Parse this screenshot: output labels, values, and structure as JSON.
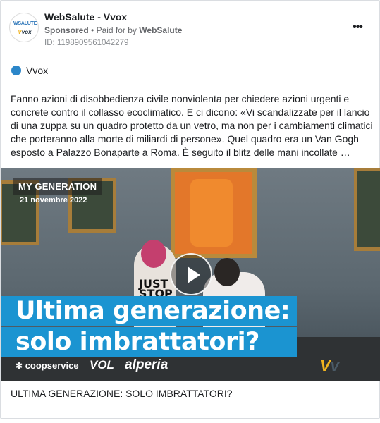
{
  "header": {
    "avatar_line1": "WSALUTE",
    "avatar_line2_a": "V",
    "avatar_line2_b": "vox",
    "page_name": "WebSalute - Vvox",
    "sponsored": "Sponsored",
    "separator": "•",
    "paid_for_by": "Paid for by",
    "payer": "WebSalute",
    "id_text": "ID: 1198909561042279",
    "more_icon": "•••"
  },
  "author": {
    "name": "Vvox",
    "dot_color": "#2b86c9"
  },
  "body": {
    "text": "Fanno azioni di disobbedienza civile nonviolenta per chiedere azioni urgenti e concrete contro il collasso ecoclimatico. E ci dicono: «Vi scandalizzate per il lancio di una zuppa su un quadro protetto da un vetro, ma non per i cambiamenti climatici che porteranno alla morte di miliardi di persone». Quel quadro era un Van Gogh esposto a Palazzo Bonaparte a Roma. È seguito il blitz delle mani incollate …"
  },
  "media": {
    "tag_title": "MY GENERATION",
    "tag_date": "21 novembre 2022",
    "shirt_line1": "JUST",
    "shirt_line2": "STOP",
    "headline_line1": "Ultima generazione:",
    "headline_line2": "solo imbrattatori?",
    "headline_bg": "#1b94d1",
    "logo_coop": "coopservice",
    "logo_coop_symbol": "✻",
    "logo_vol": "VOL",
    "logo_alperia": "alperia",
    "logo_vvox_a": "V",
    "logo_vvox_b": "v"
  },
  "caption": {
    "text": "ULTIMA GENERAZIONE: SOLO IMBRATTATORI?"
  }
}
